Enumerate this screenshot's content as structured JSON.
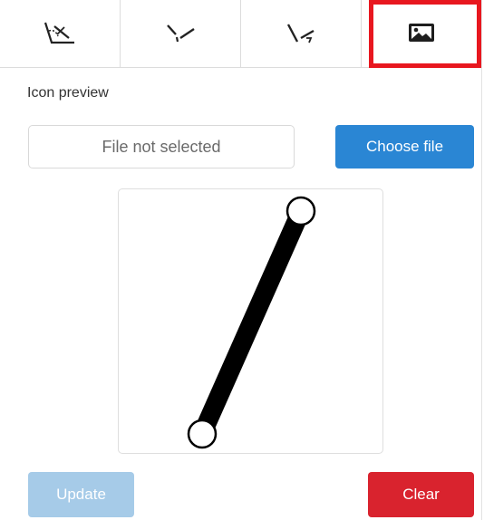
{
  "tabs": [
    {
      "icon": "angle-measure-icon",
      "selected": false
    },
    {
      "icon": "line-segment-icon",
      "selected": false
    },
    {
      "icon": "line-arrow-icon",
      "selected": false
    },
    {
      "icon": "image-icon",
      "selected": true
    }
  ],
  "icon_preview": {
    "label": "Icon preview",
    "file_status": "File not selected",
    "choose_button": "Choose file"
  },
  "actions": {
    "update_label": "Update",
    "clear_label": "Clear"
  },
  "colors": {
    "primary": "#2a86d4",
    "primary_disabled": "#a6cbe8",
    "danger": "#d9232e",
    "highlight": "#e8171f"
  }
}
